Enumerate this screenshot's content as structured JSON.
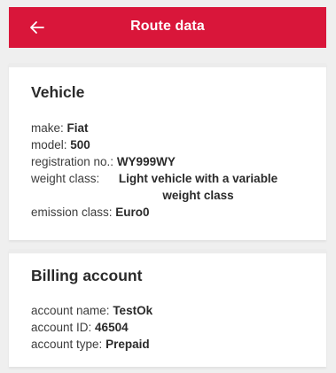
{
  "header": {
    "title": "Route data",
    "back_icon": "arrow-left-icon",
    "background_color": "#d9163a"
  },
  "vehicle": {
    "title": "Vehicle",
    "rows": [
      {
        "label": "make: ",
        "value": "Fiat"
      },
      {
        "label": "model: ",
        "value": "500"
      },
      {
        "label": "registration no.: ",
        "value": "WY999WY"
      },
      {
        "label": "weight class: ",
        "value": "Light vehicle with a variable weight class"
      },
      {
        "label": "emission class: ",
        "value": "Euro0"
      }
    ]
  },
  "billing": {
    "title": "Billing account",
    "rows": [
      {
        "label": "account name: ",
        "value": "TestOk"
      },
      {
        "label": "account ID: ",
        "value": "46504"
      },
      {
        "label": "account type: ",
        "value": "Prepaid"
      }
    ]
  }
}
